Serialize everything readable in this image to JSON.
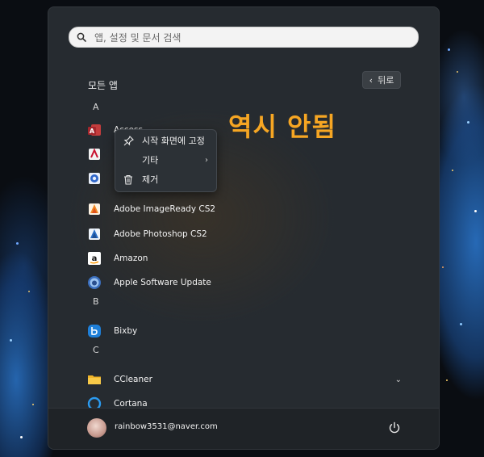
{
  "search": {
    "placeholder": "앱, 설정 및 문서 검색",
    "icon": "search-icon"
  },
  "all_apps": {
    "title": "모든 앱",
    "back_label": "뒤로"
  },
  "overlay_caption": "역시 안됨",
  "sections": [
    {
      "letter": "A"
    },
    {
      "letter": "B"
    },
    {
      "letter": "C"
    }
  ],
  "apps": [
    {
      "name": "Access",
      "icon": "access-icon"
    },
    {
      "name": "",
      "icon": "acrobat-icon"
    },
    {
      "name": "",
      "icon": "adobe-app-icon"
    },
    {
      "name": "Adobe ImageReady CS2",
      "icon": "imageready-icon"
    },
    {
      "name": "Adobe Photoshop CS2",
      "icon": "photoshop-icon"
    },
    {
      "name": "Amazon",
      "icon": "amazon-icon"
    },
    {
      "name": "Apple Software Update",
      "icon": "apple-update-icon"
    },
    {
      "name": "Bixby",
      "icon": "bixby-icon"
    },
    {
      "name": "CCleaner",
      "icon": "folder-icon"
    },
    {
      "name": "Cortana",
      "icon": "cortana-icon"
    }
  ],
  "context_menu": {
    "items": [
      {
        "label": "시작 화면에 고정",
        "icon": "pin-icon"
      },
      {
        "label": "기타",
        "icon": ""
      },
      {
        "label": "제거",
        "icon": "trash-icon"
      }
    ]
  },
  "footer": {
    "email": "rainbow3531@naver.com",
    "power_icon": "power-icon"
  },
  "colors": {
    "overlay_text": "#f6a623",
    "panel": "#262b30",
    "accent_blue": "#1e7fd8"
  }
}
